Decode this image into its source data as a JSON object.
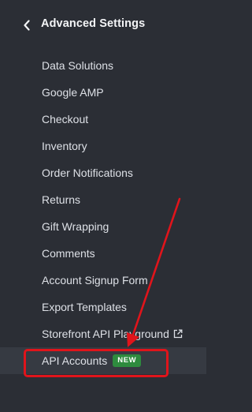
{
  "header": {
    "back_icon": "chevron-left-icon",
    "title": "Advanced Settings"
  },
  "menu": {
    "items": [
      {
        "label": "Data Solutions"
      },
      {
        "label": "Google AMP"
      },
      {
        "label": "Checkout"
      },
      {
        "label": "Inventory"
      },
      {
        "label": "Order Notifications"
      },
      {
        "label": "Returns"
      },
      {
        "label": "Gift Wrapping"
      },
      {
        "label": "Comments"
      },
      {
        "label": "Account Signup Form"
      },
      {
        "label": "Export Templates"
      },
      {
        "label": "Storefront API Playground",
        "icon": "external-link-icon"
      },
      {
        "label": "API Accounts",
        "badge": "NEW",
        "active": true
      }
    ]
  },
  "annotation": {
    "color": "#e0141b"
  },
  "colors": {
    "background": "#2b2e35",
    "active_row": "#363a42",
    "badge": "#2e8b3e"
  }
}
